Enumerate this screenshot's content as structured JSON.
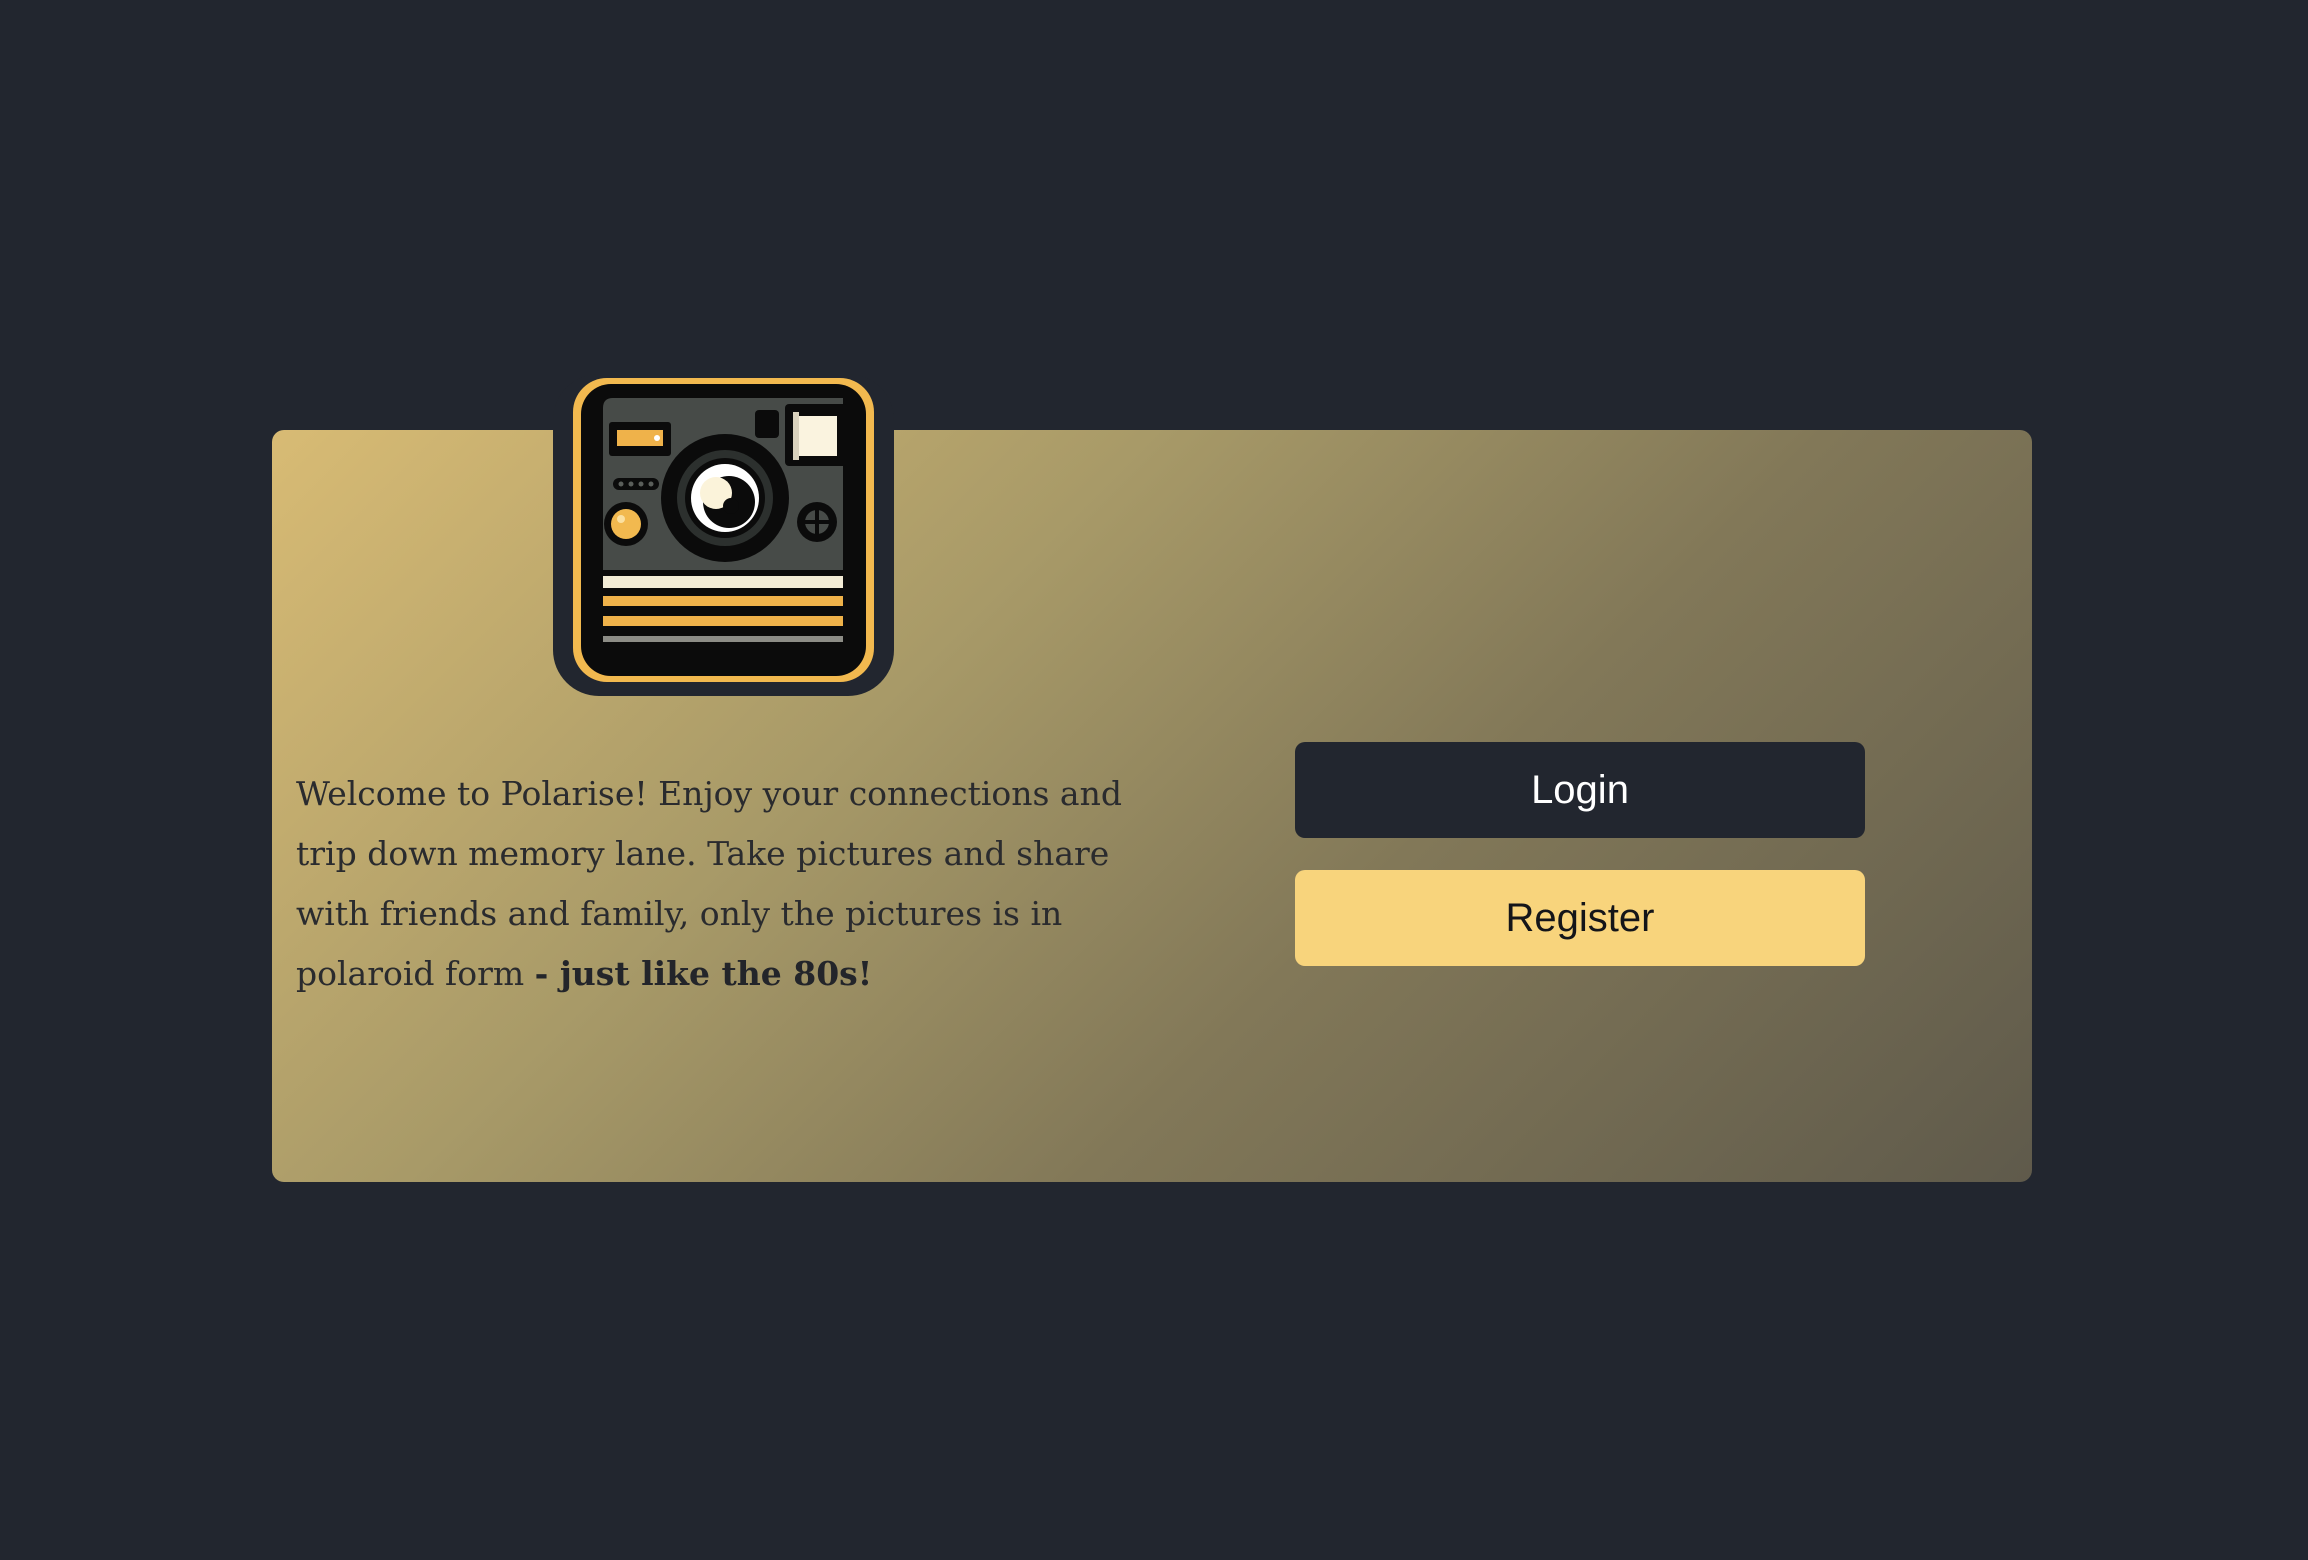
{
  "logo": {
    "icon": "polaroid-camera-icon"
  },
  "intro": {
    "text": "Welcome to Polarise! Enjoy your connections and trip down memory lane. Take pictures and share with friends and family, only the pictures is in polaroid form ",
    "emphasis": "- just like the 80s!"
  },
  "actions": {
    "login_label": "Login",
    "register_label": "Register"
  },
  "colors": {
    "background": "#22262f",
    "card_gradient_start": "#d8bb74",
    "card_gradient_end": "#5f5a4b",
    "login_button": "#22262f",
    "register_button": "#f8d47c",
    "accent": "#f2b94f"
  }
}
